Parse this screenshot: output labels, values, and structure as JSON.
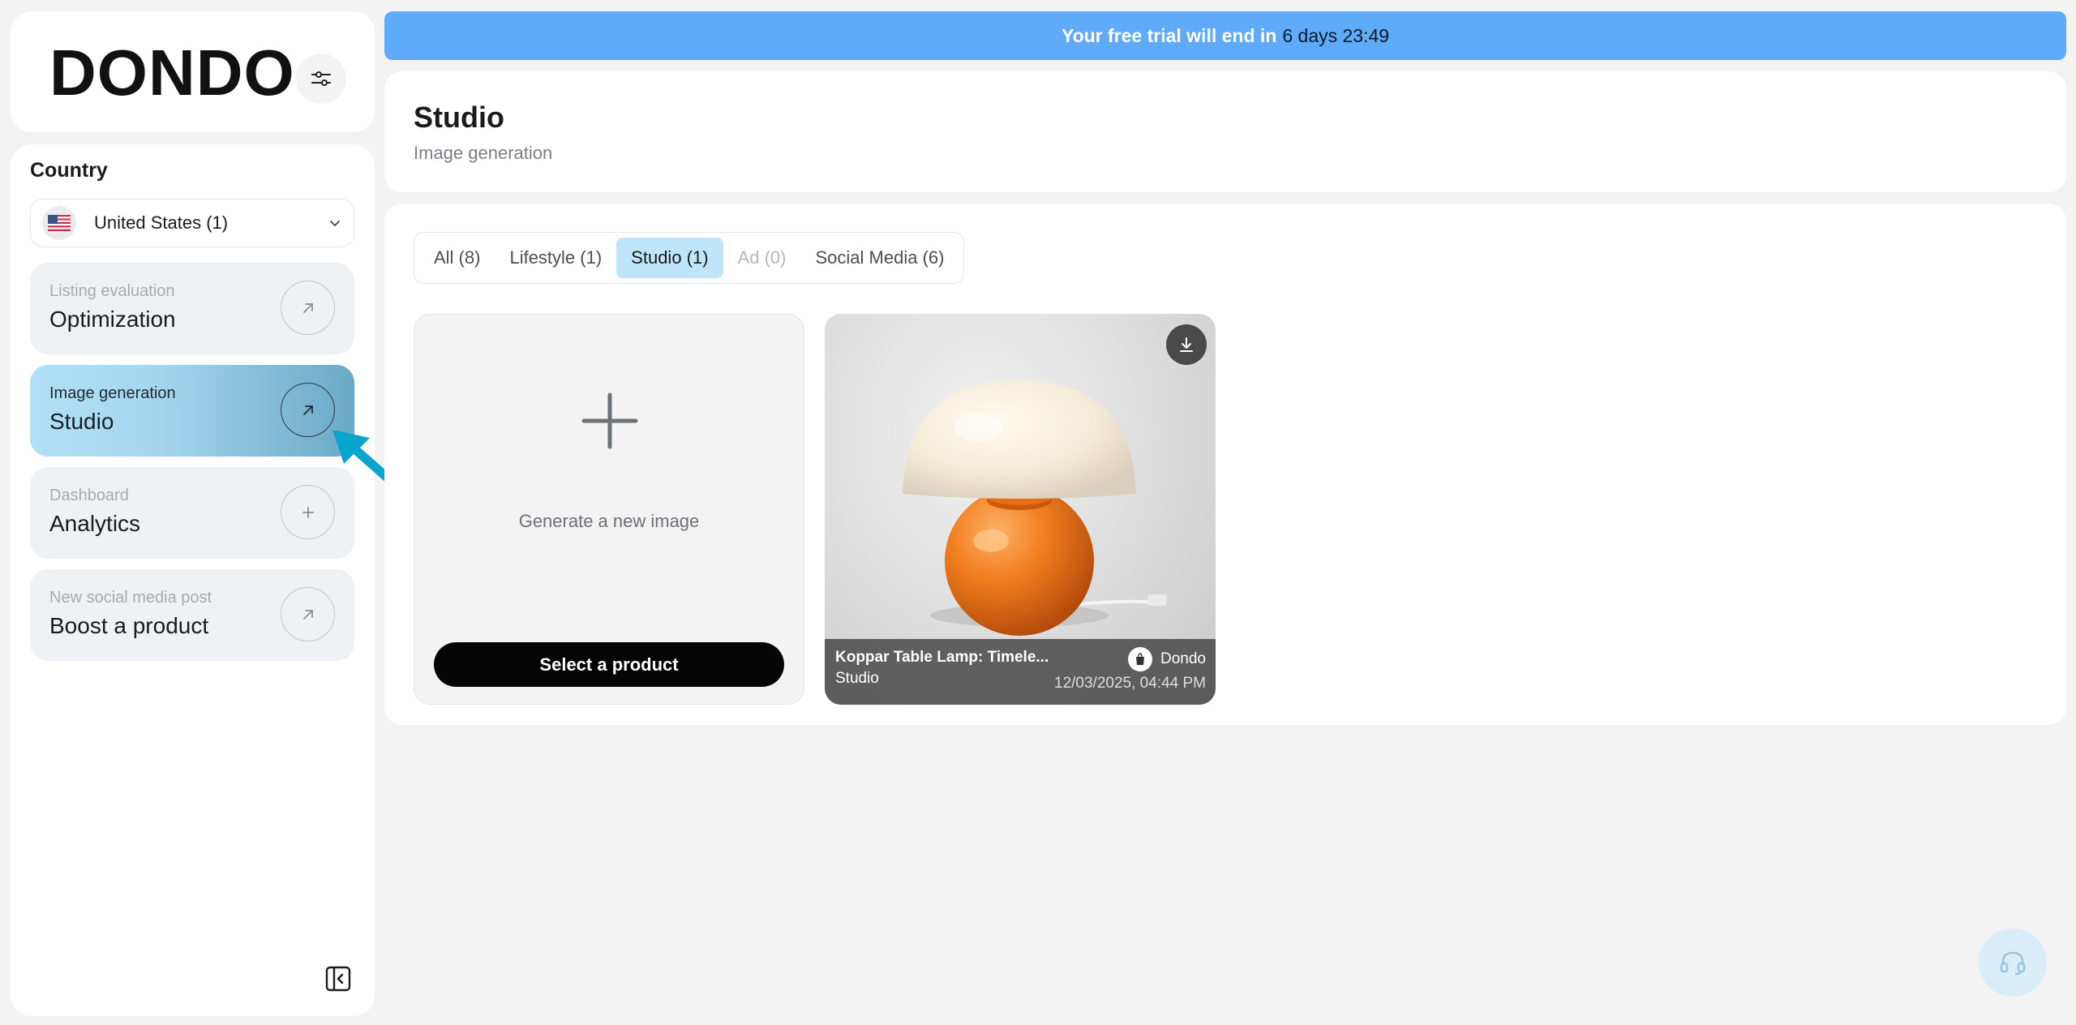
{
  "brand": {
    "logo_text": "DONDO"
  },
  "sidebar": {
    "country_label": "Country",
    "country_value": "United States (1)",
    "items": [
      {
        "sub": "Listing evaluation",
        "main": "Optimization",
        "icon": "arrow-up-right-icon"
      },
      {
        "sub": "Image generation",
        "main": "Studio",
        "icon": "arrow-up-right-icon",
        "active": true
      },
      {
        "sub": "Dashboard",
        "main": "Analytics",
        "icon": "plus-icon"
      },
      {
        "sub": "New social media post",
        "main": "Boost a product",
        "icon": "arrow-up-right-icon"
      }
    ]
  },
  "banner": {
    "text": "Your free trial will end in",
    "time": "6 days 23:49"
  },
  "header": {
    "title": "Studio",
    "subtitle": "Image generation"
  },
  "tabs": [
    {
      "label": "All (8)"
    },
    {
      "label": "Lifestyle (1)"
    },
    {
      "label": "Studio (1)",
      "active": true
    },
    {
      "label": "Ad (0)",
      "disabled": true
    },
    {
      "label": "Social Media (6)"
    }
  ],
  "new_image": {
    "text": "Generate a new image",
    "button_label": "Select a product"
  },
  "gallery": [
    {
      "name": "Koppar Table Lamp: Timele...",
      "type": "Studio",
      "brand": "Dondo",
      "date": "12/03/2025, 04:44 PM"
    }
  ],
  "colors": {
    "banner": "#5fabf9",
    "active_tab": "#bfe5fb",
    "accent_arrow": "#0aa5cf"
  }
}
